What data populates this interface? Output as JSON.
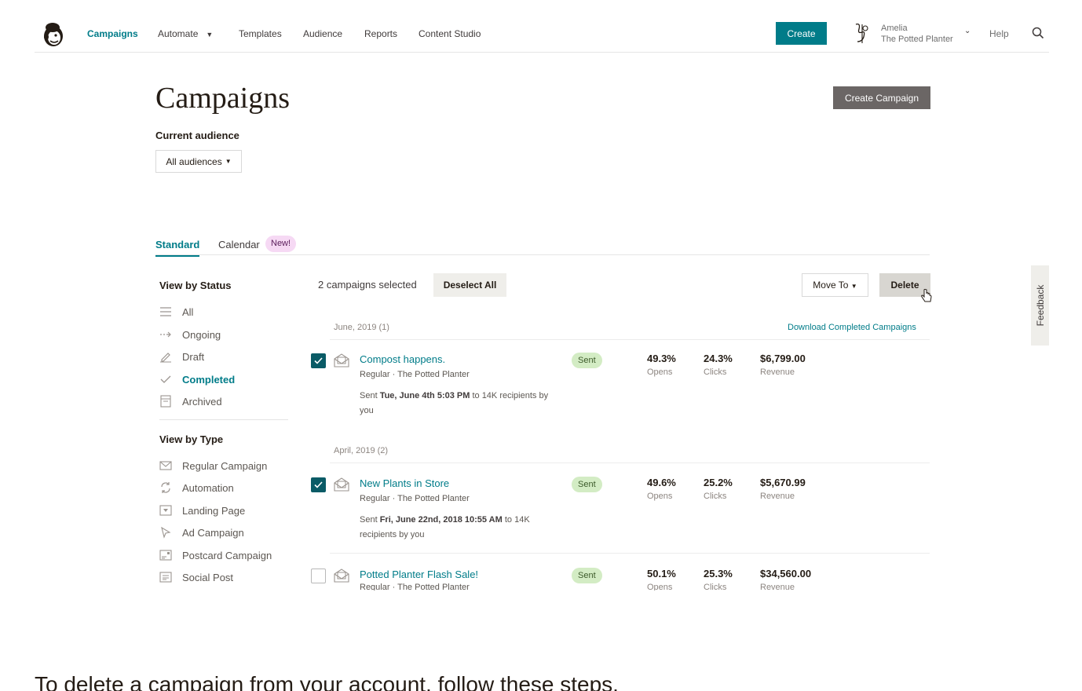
{
  "nav": {
    "items": [
      {
        "label": "Campaigns",
        "active": true
      },
      {
        "label": "Automate",
        "has_dropdown": true
      },
      {
        "label": "Templates"
      },
      {
        "label": "Audience"
      },
      {
        "label": "Reports"
      },
      {
        "label": "Content Studio"
      }
    ],
    "create_label": "Create",
    "account": {
      "name": "Amelia",
      "org": "The Potted Planter"
    },
    "help_label": "Help"
  },
  "page": {
    "title": "Campaigns",
    "create_campaign_label": "Create Campaign",
    "audience_label": "Current audience",
    "audience_value": "All audiences"
  },
  "tabs": [
    {
      "label": "Standard",
      "active": true
    },
    {
      "label": "Calendar",
      "badge": "New!"
    }
  ],
  "sidebar": {
    "status_heading": "View by Status",
    "status_items": [
      {
        "label": "All",
        "icon": "list-icon"
      },
      {
        "label": "Ongoing",
        "icon": "arrow-right-icon"
      },
      {
        "label": "Draft",
        "icon": "pencil-icon"
      },
      {
        "label": "Completed",
        "icon": "check-icon",
        "active": true
      },
      {
        "label": "Archived",
        "icon": "archive-icon"
      }
    ],
    "type_heading": "View by Type",
    "type_items": [
      {
        "label": "Regular Campaign",
        "icon": "envelope-icon"
      },
      {
        "label": "Automation",
        "icon": "refresh-icon"
      },
      {
        "label": "Landing Page",
        "icon": "landing-page-icon"
      },
      {
        "label": "Ad Campaign",
        "icon": "cursor-icon"
      },
      {
        "label": "Postcard Campaign",
        "icon": "postcard-icon"
      },
      {
        "label": "Social Post",
        "icon": "social-post-icon"
      }
    ]
  },
  "toolbar": {
    "selected_text": "2 campaigns selected",
    "deselect_label": "Deselect All",
    "move_to_label": "Move To",
    "delete_label": "Delete"
  },
  "download_link": "Download Completed Campaigns",
  "groups": [
    {
      "heading": "June, 2019 (1)",
      "campaigns": [
        {
          "title": "Compost happens.",
          "subtitle": "Regular · The Potted Planter",
          "sent_prefix": "Sent ",
          "sent_date": "Tue, June 4th 5:03 PM",
          "sent_suffix": " to 14K recipients by you",
          "status": "Sent",
          "opens": "49.3%",
          "opens_label": "Opens",
          "clicks": "24.3%",
          "clicks_label": "Clicks",
          "revenue": "$6,799.00",
          "revenue_label": "Revenue",
          "checked": true
        }
      ]
    },
    {
      "heading": "April, 2019 (2)",
      "campaigns": [
        {
          "title": "New Plants in Store",
          "subtitle": "Regular · The Potted Planter",
          "sent_prefix": "Sent ",
          "sent_date": "Fri, June 22nd, 2018 10:55 AM",
          "sent_suffix": " to 14K recipients by you",
          "status": "Sent",
          "opens": "49.6%",
          "opens_label": "Opens",
          "clicks": "25.2%",
          "clicks_label": "Clicks",
          "revenue": "$5,670.99",
          "revenue_label": "Revenue",
          "checked": true
        },
        {
          "title": "Potted Planter Flash Sale!",
          "subtitle": "Regular · The Potted Planter",
          "status": "Sent",
          "opens": "50.1%",
          "opens_label": "Opens",
          "clicks": "25.3%",
          "clicks_label": "Clicks",
          "revenue": "$34,560.00",
          "revenue_label": "Revenue",
          "checked": false
        }
      ]
    }
  ],
  "feedback_label": "Feedback",
  "bottom_text": "To delete a campaign from your account, follow these steps.",
  "colors": {
    "accent": "#007c89",
    "sent_badge": "#d3ecc4",
    "new_badge": "#f6d9f4"
  }
}
